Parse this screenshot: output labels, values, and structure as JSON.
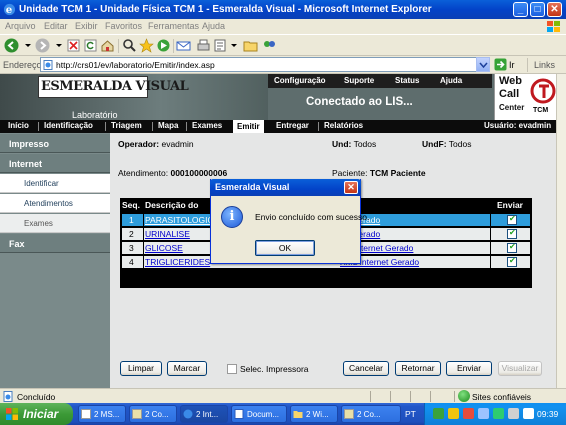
{
  "window": {
    "title": "Unidade TCM 1 - Unidade Física TCM 1 - Esmeralda Visual - Microsoft Internet Explorer",
    "minimize": "_",
    "maximize": "□",
    "close": "✕"
  },
  "menu": [
    "Arquivo",
    "Editar",
    "Exibir",
    "Favoritos",
    "Ferramentas",
    "Ajuda"
  ],
  "address": {
    "label": "Endereço",
    "url": "http://crs01/ev/laboratorio/Emitir/index.asp",
    "go": "Ir",
    "links": "Links"
  },
  "header": {
    "logo": "ESMERALDA VISUAL",
    "logo_sub": "",
    "module": "Laboratório",
    "topnav": [
      "Configuração",
      "Suporte",
      "Status",
      "Ajuda"
    ],
    "connected": "Conectado ao LIS...",
    "webcall": [
      "Web",
      "Call",
      "Center"
    ],
    "tcm": "TCM"
  },
  "nav": {
    "items": [
      "Início",
      "Identificação",
      "Triagem",
      "Mapa",
      "Exames",
      "Emitir",
      "Entregar",
      "Relatórios"
    ],
    "active": "Emitir",
    "user": "Usuário: evadmin"
  },
  "sidebar": {
    "impresso": "Impresso",
    "internet": "Internet",
    "items": [
      "Identificar",
      "Atendimentos",
      "Exames"
    ],
    "fax": "Fax"
  },
  "main": {
    "operador_label": "Operador:",
    "operador": "evadmin",
    "und_label": "Und:",
    "und": "Todos",
    "undf_label": "UndF:",
    "undf": "Todos",
    "atendimento_label": "Atendimento:",
    "atendimento": "000100000006",
    "paciente_label": "Paciente:",
    "paciente": "TCM Paciente"
  },
  "table": {
    "headers": {
      "seq": "Seq.",
      "descricao": "Descrição do",
      "enviar": "Enviar"
    },
    "rows": [
      {
        "seq": "1",
        "descricao": "PARASITOLOGIC",
        "status": "o Liberado"
      },
      {
        "seq": "2",
        "descricao": "URINALISE",
        "status": "o Liberado"
      },
      {
        "seq": "3",
        "descricao": "GLICOSE",
        "status": "ML Internet Gerado"
      },
      {
        "seq": "4",
        "descricao": "TRIGLICERIDES",
        "status": "XML Internet Gerado"
      }
    ]
  },
  "buttons": {
    "limpar": "Limpar",
    "marcar": "Marcar",
    "selec_impressora": "Selec. Impressora",
    "cancelar": "Cancelar",
    "retornar": "Retornar",
    "enviar": "Enviar",
    "visualizar": "Visualizar"
  },
  "dialog": {
    "title": "Esmeralda Visual",
    "icon": "i",
    "message": "Envio concluído com sucesso.",
    "ok": "OK",
    "close": "✕"
  },
  "status": {
    "text": "Concluído",
    "zone": "Sites confiáveis"
  },
  "taskbar": {
    "start": "Iniciar",
    "tasks": [
      "2 MS...",
      "2 Co...",
      "2 Int...",
      "Docum...",
      "2 Wi...",
      "2 Co..."
    ],
    "lang": "PT",
    "clock": "09:39"
  },
  "colors": {
    "accent": "#0a5fd9",
    "selected_row": "#2e9ddc",
    "link": "#0000cc"
  }
}
